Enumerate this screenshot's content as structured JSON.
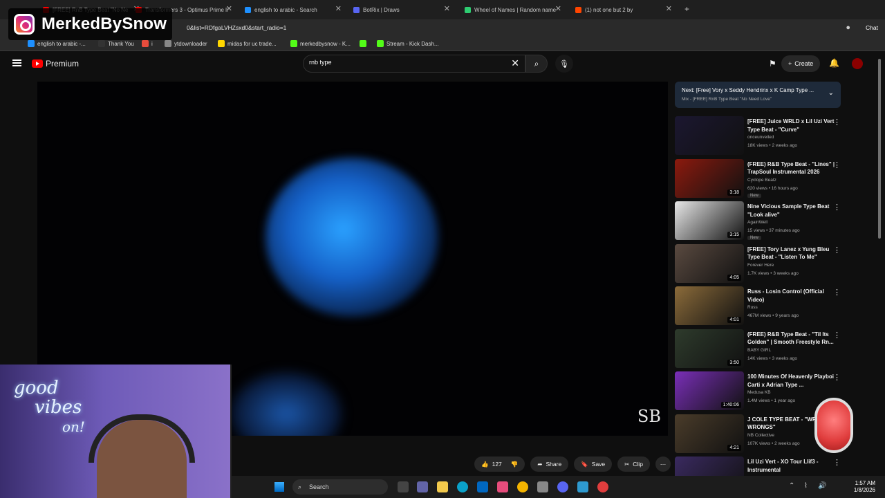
{
  "browser": {
    "tabs": [
      {
        "label": "[FREE] RnB Type Beat \"No Ne",
        "color": "#ff0000"
      },
      {
        "label": "Transformers 3 - Optimus Prime li",
        "color": "#ff0000"
      },
      {
        "label": "english to arabic - Search",
        "color": "#1e90ff"
      },
      {
        "label": "BotRix | Draws",
        "color": "#5865f2"
      },
      {
        "label": "Wheel of Names | Random name",
        "color": "#2ecc71"
      },
      {
        "label": "(1) not one but 2 by",
        "color": "#ff4500"
      }
    ],
    "url": "0&list=RDfgaLVHZsxd0&start_radio=1",
    "bookmarks": [
      "english to arabic -...",
      "Thank You",
      "i",
      "ytdownloader",
      "midas for uc trade...",
      "merkedbysnow - K...",
      "",
      "Stream - Kick Dash..."
    ],
    "chat_label": "Chat"
  },
  "overlay": {
    "instagram_handle": "MerkedBySnow"
  },
  "youtube": {
    "logo_text": "Premium",
    "search_value": "rnb type",
    "create_label": "Create",
    "watermark": "SB",
    "actions": {
      "likes": "127",
      "share": "Share",
      "save": "Save",
      "clip": "Clip"
    }
  },
  "next_up": {
    "title": "Next: [Free] Vory x Seddy Hendrinx x K Camp Type ...",
    "subtitle": "Mix - [FREE] RnB Type Beat \"No Need Love\""
  },
  "recommendations": [
    {
      "title": "[FREE] Juice WRLD x Lil Uzi Vert Type Beat - \"Curve\"",
      "channel": "onceunveiled",
      "meta": "18K views • 2 weeks ago",
      "duration": "",
      "is_new": false,
      "thumb": "#1b1730"
    },
    {
      "title": "(FREE) R&B Type Beat - \"Lines\" | TrapSoul Instrumental 2026",
      "channel": "Cyclope Beatz",
      "meta": "620 views • 16 hours ago",
      "duration": "3:18",
      "is_new": true,
      "thumb": "#8c1a0e"
    },
    {
      "title": "Nine Vicious Sample Type Beat \"Look alive\"",
      "channel": "AgainWell",
      "meta": "15 views • 37 minutes ago",
      "duration": "3:15",
      "is_new": true,
      "thumb": "#e8e8e8"
    },
    {
      "title": "[FREE] Tory Lanez x Yung Bleu Type Beat - \"Listen To Me\"",
      "channel": "Forever Here",
      "meta": "1.7K views • 3 weeks ago",
      "duration": "4:05",
      "is_new": false,
      "thumb": "#5a4a40"
    },
    {
      "title": "Russ - Losin Control (Official Video)",
      "channel": "Russ",
      "meta": "467M views • 9 years ago",
      "duration": "4:01",
      "is_new": false,
      "thumb": "#8b6b3a"
    },
    {
      "title": "(FREE) R&B Type Beat - \"Til Its Golden\" | Smooth Freestyle Rn...",
      "channel": "BABY GIRL",
      "meta": "14K views • 3 weeks ago",
      "duration": "3:50",
      "is_new": false,
      "thumb": "#2e3b2c"
    },
    {
      "title": "100 Minutes Of Heavenly Playboi Carti x Adrian Type ...",
      "channel": "Medusa KB",
      "meta": "1.4M views • 1 year ago",
      "duration": "1:40:06",
      "is_new": false,
      "thumb": "#7a2fb8"
    },
    {
      "title": "J COLE TYPE BEAT - \"WR... WRONGS\"",
      "channel": "NB Collective",
      "meta": "107K views • 2 weeks ago",
      "duration": "4:21",
      "is_new": false,
      "thumb": "#4a3c2a"
    },
    {
      "title": "Lil Uzi Vert - XO Tour Llif3 - Instrumental",
      "channel": "",
      "meta": "",
      "duration": "",
      "is_new": false,
      "thumb": "#3a2a60"
    }
  ],
  "webcam": {
    "neon_text_line1": "good",
    "neon_text_line2": "vibes",
    "neon_text_line3": "on!"
  },
  "taskbar": {
    "search_label": "Search",
    "time": "1:57 AM",
    "date": "1/8/2026"
  }
}
